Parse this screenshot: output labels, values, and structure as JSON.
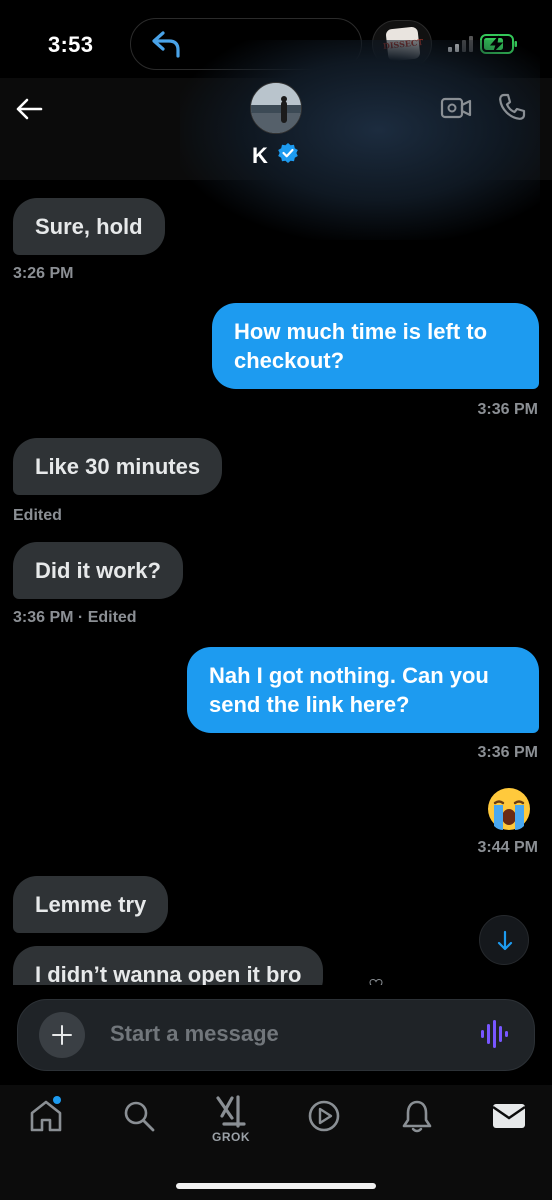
{
  "status_bar": {
    "time": "3:53",
    "island_app_text": "DISSECT"
  },
  "header": {
    "contact_name": "K"
  },
  "messages": [
    {
      "text": "Sure, hold",
      "meta": "3:26 PM"
    },
    {
      "text": "How much time is left to checkout?",
      "meta": "3:36 PM"
    },
    {
      "text": "Like 30 minutes",
      "meta": "Edited"
    },
    {
      "text": "Did it work?",
      "meta": "3:36 PM · Edited"
    },
    {
      "text": "Nah I got nothing. Can you send the link here?",
      "meta": "3:36 PM"
    },
    {
      "text": "😭",
      "meta": "3:44 PM"
    },
    {
      "text": "Lemme try"
    },
    {
      "text": "I didn’t wanna open it bro"
    }
  ],
  "composer": {
    "placeholder": "Start a message"
  },
  "tabbar": {
    "grok_label": "GROK"
  },
  "colors": {
    "accent": "#1d9bf0",
    "incoming_bubble": "#2f3336",
    "voice": "#7856ff"
  }
}
